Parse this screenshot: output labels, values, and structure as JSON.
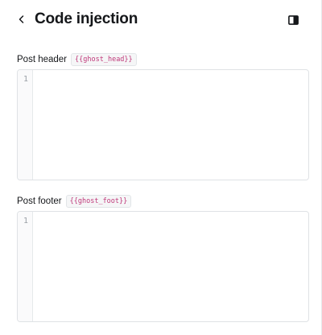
{
  "header": {
    "title": "Code injection",
    "back_icon": "chevron-left-icon",
    "sidebar_toggle_icon": "sidebar-toggle-icon"
  },
  "post_header": {
    "label": "Post header",
    "tag": "{{ghost_head}}",
    "line_number": "1",
    "value": ""
  },
  "post_footer": {
    "label": "Post footer",
    "tag": "{{ghost_foot}}",
    "line_number": "1",
    "value": ""
  },
  "colors": {
    "tag_text": "#c0397a",
    "border": "#dfe2e5",
    "text": "#15171a"
  }
}
